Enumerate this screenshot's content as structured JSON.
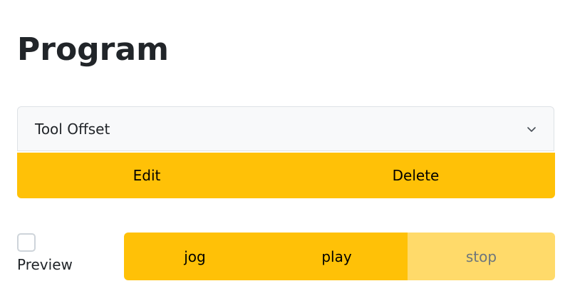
{
  "page": {
    "title": "Program"
  },
  "program_select": {
    "selected": "Tool Offset",
    "icon": "chevron-down-icon"
  },
  "program_actions": {
    "edit_label": "Edit",
    "delete_label": "Delete"
  },
  "preview": {
    "label": "Preview",
    "checked": false
  },
  "controls": {
    "jog_label": "jog",
    "play_label": "play",
    "stop_label": "stop",
    "stop_disabled": true
  },
  "colors": {
    "accent": "#ffc107",
    "accent_disabled": "#ffda6a"
  }
}
